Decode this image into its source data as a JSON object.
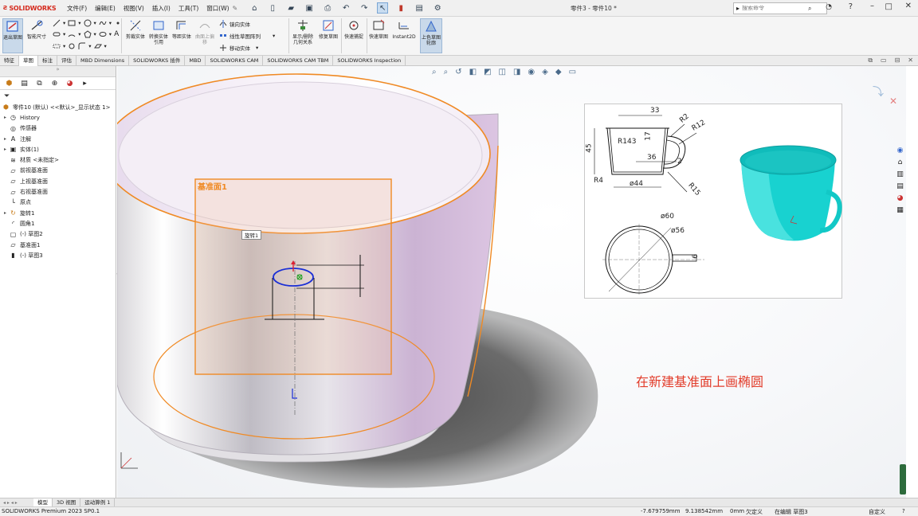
{
  "app": {
    "brand": "SOLIDWORKS",
    "title": "零件3 - 零件10 *"
  },
  "menu": [
    "文件(F)",
    "编辑(E)",
    "视图(V)",
    "插入(I)",
    "工具(T)",
    "窗口(W)"
  ],
  "search": {
    "placeholder": "搜索命令"
  },
  "ribbon": {
    "buttons": [
      {
        "label": "退出草图"
      },
      {
        "label": "智能尺寸"
      },
      {
        "label": "剪裁实体"
      },
      {
        "label": "转换实体引用"
      },
      {
        "label": "等距实体"
      },
      {
        "label": "曲面上偏移"
      },
      {
        "label": "镜向实体"
      },
      {
        "label": "线性草图阵列"
      },
      {
        "label": "移动实体"
      },
      {
        "label": "显示/删除几何关系"
      },
      {
        "label": "修复草图"
      },
      {
        "label": "快速捕捉"
      },
      {
        "label": "快速草图"
      },
      {
        "label": "Instant2D"
      },
      {
        "label": "上色草图轮廓"
      }
    ]
  },
  "tabs": [
    "特征",
    "草图",
    "标注",
    "评估",
    "MBD Dimensions",
    "SOLIDWORKS 插件",
    "MBD",
    "SOLIDWORKS CAM",
    "SOLIDWORKS CAM TBM",
    "SOLIDWORKS Inspection"
  ],
  "tree": {
    "root": "零件10 (默认) <<默认>_显示状态 1>",
    "items": [
      {
        "label": "History",
        "expand": "▸"
      },
      {
        "label": "传感器",
        "expand": ""
      },
      {
        "label": "注解",
        "expand": "▸"
      },
      {
        "label": "实体(1)",
        "expand": "▸"
      },
      {
        "label": "材质 <未指定>",
        "expand": ""
      },
      {
        "label": "前视基准面",
        "expand": ""
      },
      {
        "label": "上视基准面",
        "expand": ""
      },
      {
        "label": "右视基准面",
        "expand": ""
      },
      {
        "label": "原点",
        "expand": ""
      },
      {
        "label": "旋转1",
        "expand": "▸"
      },
      {
        "label": "圆角1",
        "expand": ""
      },
      {
        "label": "(-) 草图2",
        "expand": ""
      },
      {
        "label": "基准面1",
        "expand": ""
      },
      {
        "label": "(-) 草图3",
        "expand": ""
      }
    ]
  },
  "viewport": {
    "plane_label": "基准面1",
    "tooltip": "旋转1",
    "annotation": "在新建基准面上画椭圆"
  },
  "drawing": {
    "dims": [
      "33",
      "R2",
      "R12",
      "17",
      "R143",
      "45",
      "36",
      "R4",
      "ø44",
      "2",
      "R15",
      "ø60",
      "ø56",
      "6"
    ]
  },
  "bottom_tabs": [
    "模型",
    "3D 视图",
    "运动算例 1"
  ],
  "status": {
    "product": "SOLIDWORKS Premium 2023 SP0.1",
    "x": "-7.679759mm",
    "y": "9.138542mm",
    "z": "0mm",
    "defined": "欠定义",
    "editing": "在编辑 草图3",
    "custom": "自定义"
  },
  "colors": {
    "accent": "#d52b1e",
    "sketch_orange": "#f08a24",
    "cup_teal": "#1fd7d4",
    "annotation_red": "#e23c2a"
  }
}
